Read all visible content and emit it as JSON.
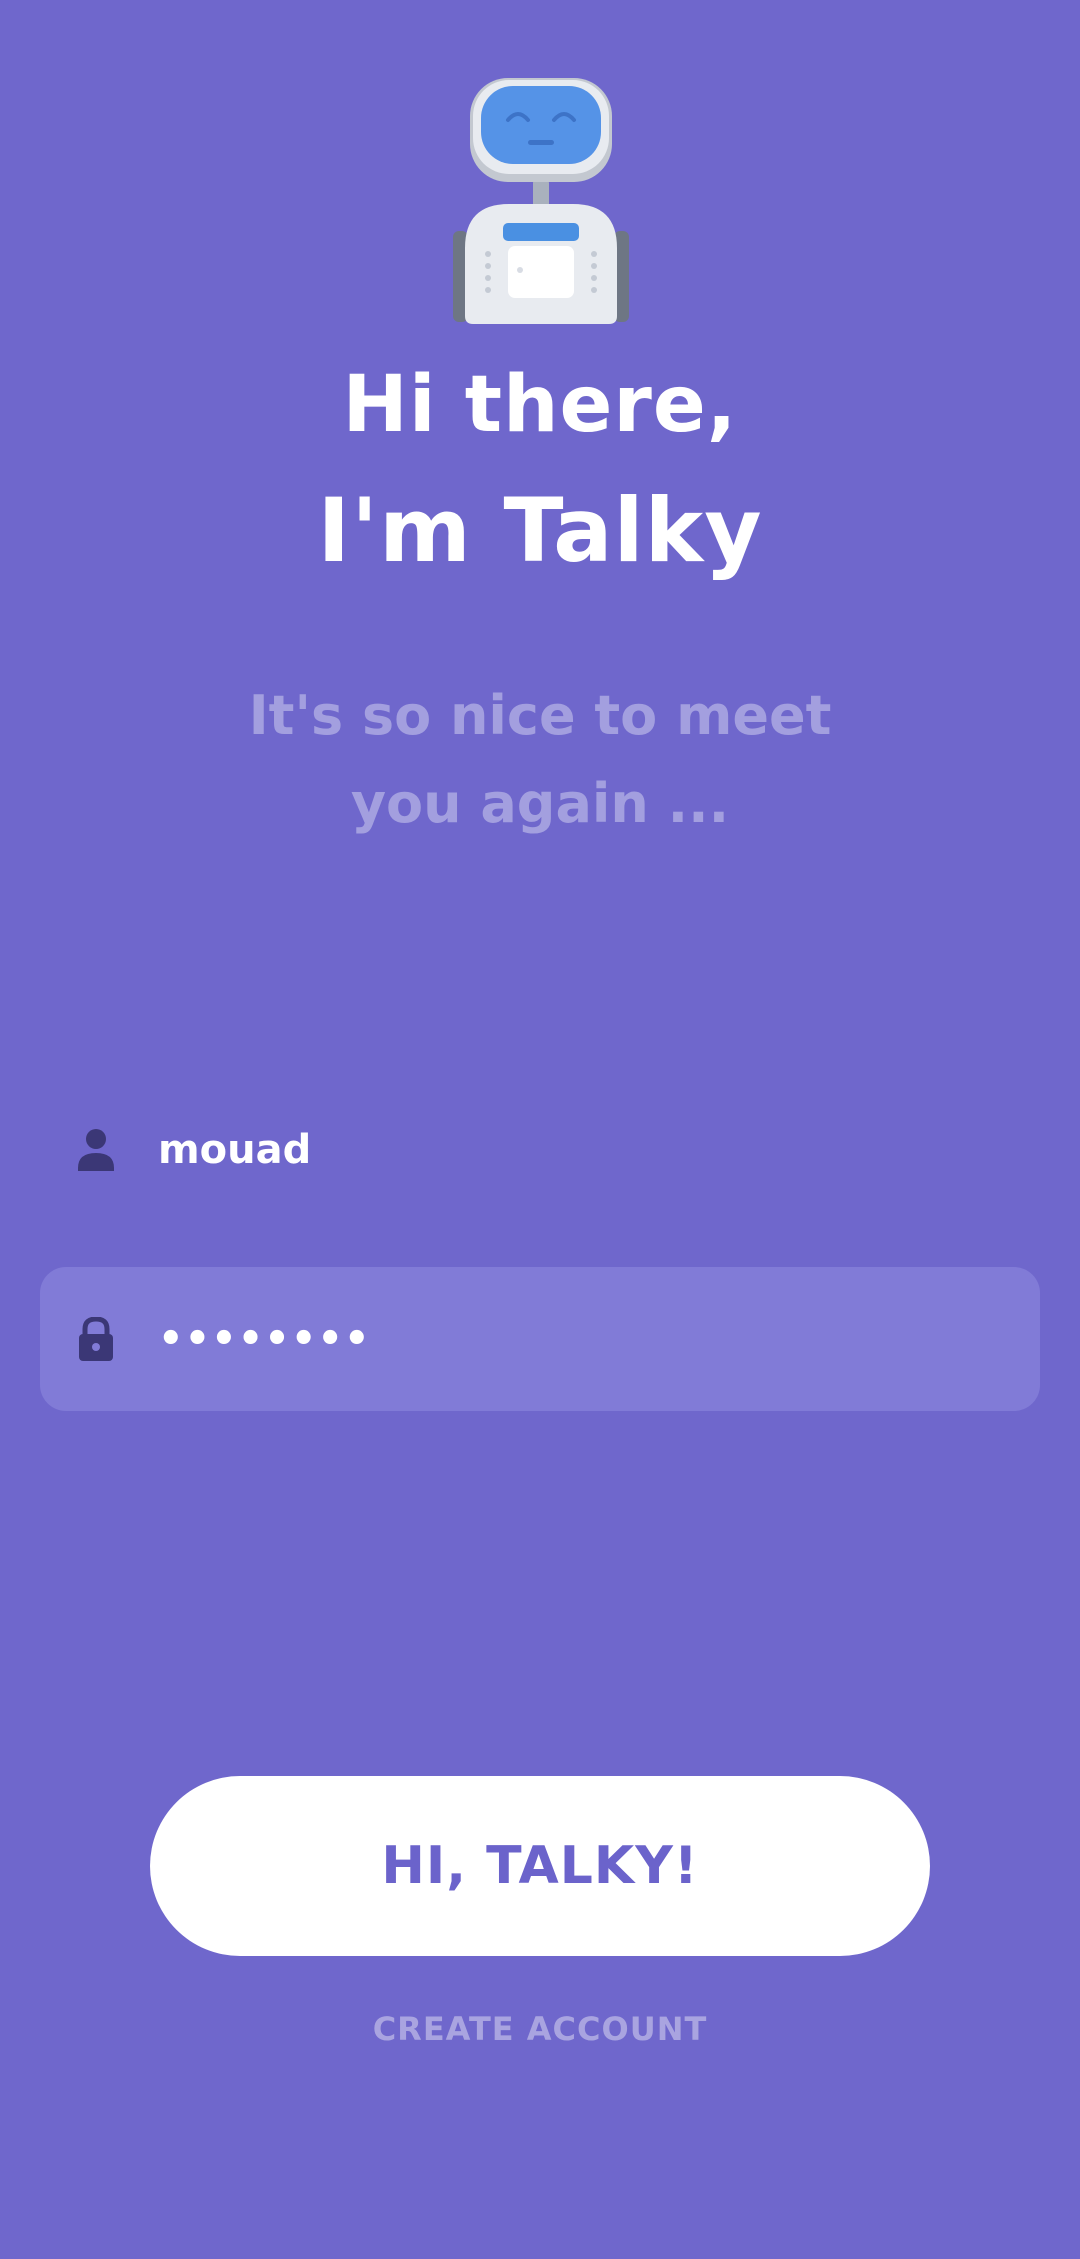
{
  "hero": {
    "title_line_1": "Hi there,",
    "title_line_2": "I'm Talky",
    "subtitle": "It's so nice to meet you again ...",
    "mascot_icon": "robot-mascot-icon"
  },
  "login_form": {
    "username": {
      "icon": "user-icon",
      "value": "mouad"
    },
    "password": {
      "icon": "lock-icon",
      "value": "••••••••"
    }
  },
  "actions": {
    "submit_label": "HI, TALKY!",
    "create_account_label": "CREATE ACCOUNT"
  },
  "colors": {
    "background": "#6f67cc",
    "field_background": "#817bd7",
    "button_background": "#ffffff",
    "button_text": "#6b63cb",
    "muted_text": "#a39fdf"
  }
}
